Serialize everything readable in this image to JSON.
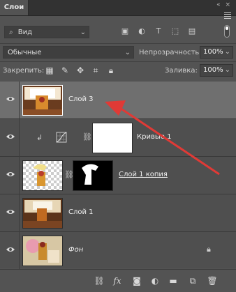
{
  "panel": {
    "tab_title": "Слои",
    "window_controls": "« ×"
  },
  "filter": {
    "kind_label": "Вид",
    "kind_icon": "search-icon"
  },
  "blend": {
    "mode": "Обычные",
    "opacity_label": "Непрозрачность:",
    "opacity_value": "100%"
  },
  "locks": {
    "label": "Закрепить:",
    "fill_label": "Заливка:",
    "fill_value": "100%"
  },
  "layers": [
    {
      "name": "Слой 3",
      "selected": true
    },
    {
      "name": "Кривые 1"
    },
    {
      "name": "Слой 1 копия"
    },
    {
      "name": "Слой 1"
    },
    {
      "name": "Фон",
      "locked": true
    }
  ],
  "bottom": {
    "fx_label": "fx"
  },
  "colors": {
    "panel": "#535353",
    "selected_row": "#6f6f6f",
    "arrow": "#e03a36"
  }
}
